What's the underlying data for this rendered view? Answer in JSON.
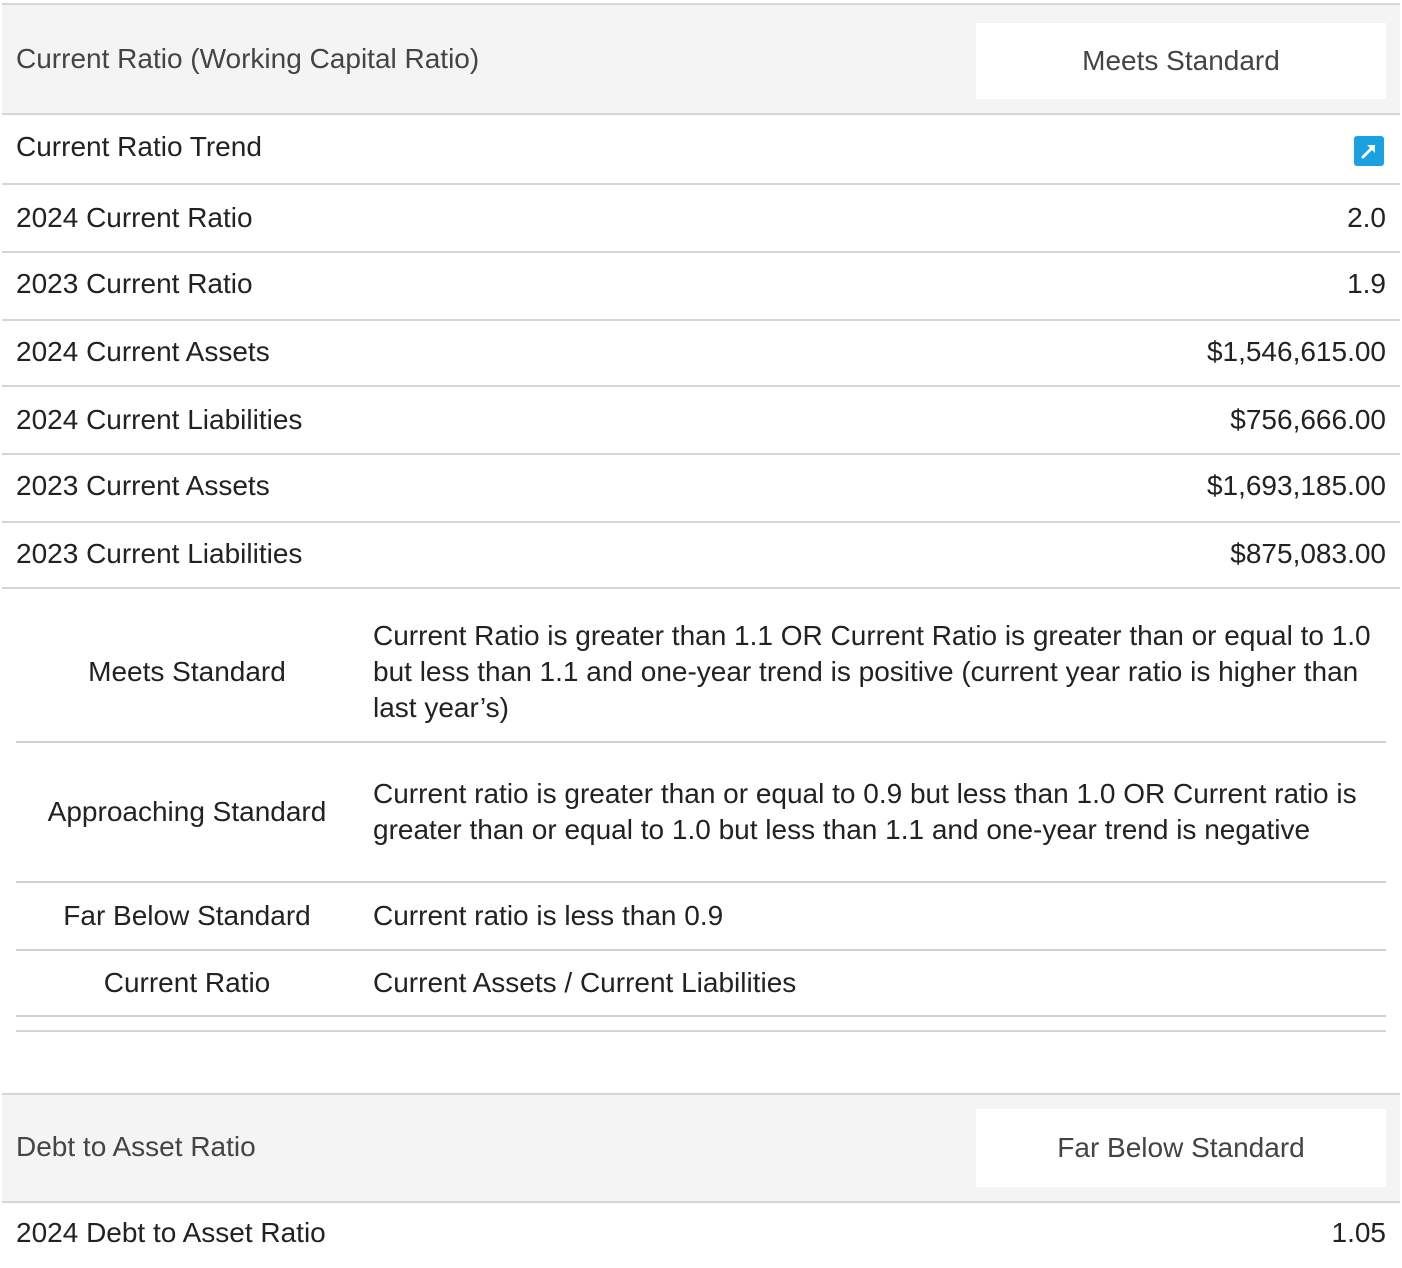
{
  "current_ratio_section": {
    "title": "Current Ratio (Working Capital Ratio)",
    "status": "Meets Standard",
    "trend_label": "Current Ratio Trend",
    "trend_icon": "trend-up-icon",
    "rows": [
      {
        "label": "2024 Current Ratio",
        "value": "2.0"
      },
      {
        "label": "2023 Current Ratio",
        "value": "1.9"
      },
      {
        "label": "2024 Current Assets",
        "value": "$1,546,615.00"
      },
      {
        "label": "2024 Current Liabilities",
        "value": "$756,666.00"
      },
      {
        "label": "2023 Current Assets",
        "value": "$1,693,185.00"
      },
      {
        "label": "2023 Current Liabilities",
        "value": "$875,083.00"
      }
    ],
    "standards": [
      {
        "name": "Meets Standard",
        "description": "Current Ratio is greater than 1.1 OR Current Ratio is greater than or equal to 1.0 but less than 1.1 and one-year trend is positive (current year ratio is higher than last year’s)"
      },
      {
        "name": "Approaching Standard",
        "description": "Current ratio is greater than or equal to 0.9 but less than 1.0 OR Current ratio is greater than or equal to 1.0 but less than 1.1 and one-year trend is negative"
      },
      {
        "name": "Far Below Standard",
        "description": "Current ratio is less than 0.9"
      },
      {
        "name": "Current Ratio",
        "description": "Current Assets / Current Liabilities"
      }
    ]
  },
  "debt_section": {
    "title": "Debt to Asset Ratio",
    "status": "Far Below Standard",
    "rows": [
      {
        "label": "2024 Debt to Asset Ratio",
        "value": "1.05"
      }
    ]
  },
  "colors": {
    "header_bg": "#f4f4f4",
    "border": "#d6d6d6",
    "trend_icon_bg": "#1ba1e2"
  }
}
